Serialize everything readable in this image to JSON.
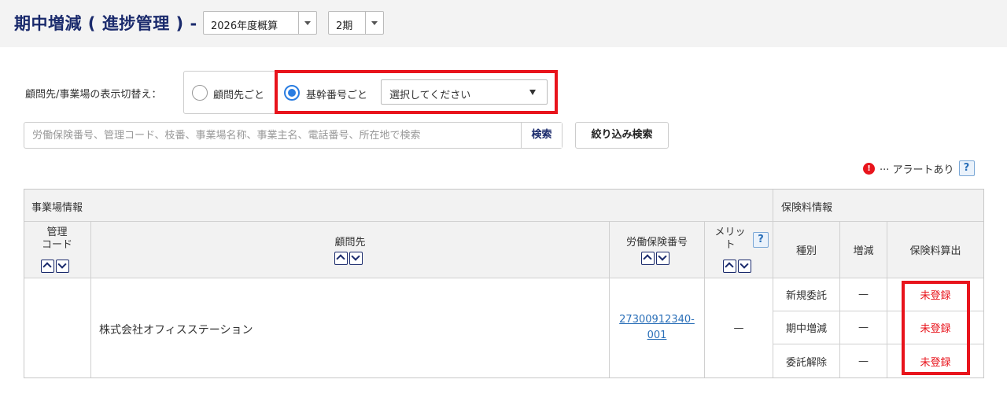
{
  "header": {
    "title": "期中増減 ( 進捗管理 ) -",
    "year_select": "2026年度概算",
    "period_select": "2期"
  },
  "display_toggle": {
    "label": "顧問先/事業場の表示切替え：",
    "option_client": "顧問先ごと",
    "option_core": "基幹番号ごと",
    "selected": "option_core",
    "core_select_placeholder": "選択してください"
  },
  "search": {
    "placeholder": "労働保険番号、管理コード、枝番、事業場名称、事業主名、電話番号、所在地で検索",
    "button": "検索",
    "filter_button": "絞り込み検索"
  },
  "alert_legend": {
    "icon": "!",
    "text": "··· アラートあり",
    "help": "?"
  },
  "table": {
    "group_business": "事業場情報",
    "group_insurance": "保険料情報",
    "col_code": "管理\nコード",
    "col_client": "顧問先",
    "col_labor_no": "労働保険番号",
    "col_merit": "メリッ\nト",
    "col_type": "種別",
    "col_change": "増減",
    "col_calc": "保険料算出",
    "help": "?",
    "rows": [
      {
        "code": "",
        "client": "株式会社オフィスステーション",
        "labor_no": "27300912340-001",
        "merit": "—",
        "items": [
          {
            "type": "新規委託",
            "change": "—",
            "calc": "未登録"
          },
          {
            "type": "期中増減",
            "change": "—",
            "calc": "未登録"
          },
          {
            "type": "委託解除",
            "change": "—",
            "calc": "未登録"
          }
        ]
      }
    ]
  },
  "colors": {
    "title": "#1a2a6c",
    "accent_blue": "#2a7de1",
    "alert_red": "#e8141c",
    "link": "#2a6fb8"
  }
}
